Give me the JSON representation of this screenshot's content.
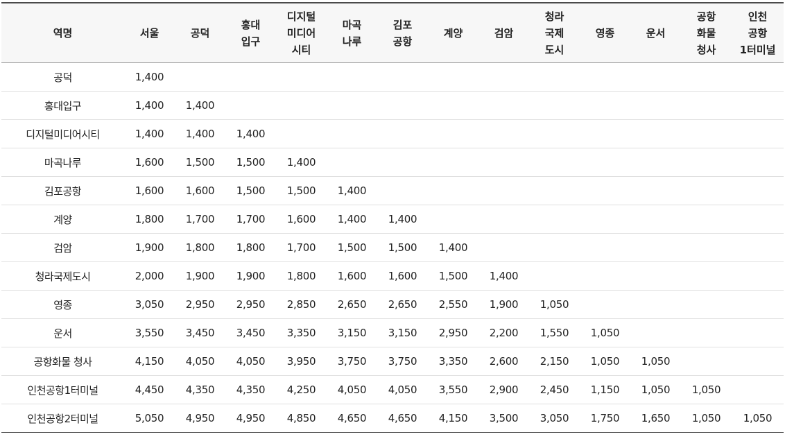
{
  "header": {
    "corner": "역명",
    "columns": [
      [
        "서울"
      ],
      [
        "공덕"
      ],
      [
        "홍대",
        "입구"
      ],
      [
        "디지털",
        "미디어",
        "시티"
      ],
      [
        "마곡",
        "나루"
      ],
      [
        "김포",
        "공항"
      ],
      [
        "계양"
      ],
      [
        "검암"
      ],
      [
        "청라",
        "국제",
        "도시"
      ],
      [
        "영종"
      ],
      [
        "운서"
      ],
      [
        "공항",
        "화물",
        "청사"
      ],
      [
        "인천",
        "공항",
        "1터미널"
      ]
    ]
  },
  "rows": [
    {
      "station": "공덕",
      "fares": [
        "1,400"
      ]
    },
    {
      "station": "홍대입구",
      "fares": [
        "1,400",
        "1,400"
      ]
    },
    {
      "station": "디지털미디어시티",
      "fares": [
        "1,400",
        "1,400",
        "1,400"
      ]
    },
    {
      "station": "마곡나루",
      "fares": [
        "1,600",
        "1,500",
        "1,500",
        "1,400"
      ]
    },
    {
      "station": "김포공항",
      "fares": [
        "1,600",
        "1,600",
        "1,500",
        "1,500",
        "1,400"
      ]
    },
    {
      "station": "계양",
      "fares": [
        "1,800",
        "1,700",
        "1,700",
        "1,600",
        "1,400",
        "1,400"
      ]
    },
    {
      "station": "검암",
      "fares": [
        "1,900",
        "1,800",
        "1,800",
        "1,700",
        "1,500",
        "1,500",
        "1,400"
      ]
    },
    {
      "station": "청라국제도시",
      "fares": [
        "2,000",
        "1,900",
        "1,900",
        "1,800",
        "1,600",
        "1,600",
        "1,500",
        "1,400"
      ]
    },
    {
      "station": "영종",
      "fares": [
        "3,050",
        "2,950",
        "2,950",
        "2,850",
        "2,650",
        "2,650",
        "2,550",
        "1,900",
        "1,050"
      ]
    },
    {
      "station": "운서",
      "fares": [
        "3,550",
        "3,450",
        "3,450",
        "3,350",
        "3,150",
        "3,150",
        "2,950",
        "2,200",
        "1,550",
        "1,050"
      ]
    },
    {
      "station": "공항화물 청사",
      "fares": [
        "4,150",
        "4,050",
        "4,050",
        "3,950",
        "3,750",
        "3,750",
        "3,350",
        "2,600",
        "2,150",
        "1,050",
        "1,050"
      ]
    },
    {
      "station": "인천공항1터미널",
      "fares": [
        "4,450",
        "4,350",
        "4,350",
        "4,250",
        "4,050",
        "4,050",
        "3,550",
        "2,900",
        "2,450",
        "1,150",
        "1,050",
        "1,050"
      ]
    },
    {
      "station": "인천공항2터미널",
      "fares": [
        "5,050",
        "4,950",
        "4,950",
        "4,850",
        "4,650",
        "4,650",
        "4,150",
        "3,500",
        "3,050",
        "1,750",
        "1,650",
        "1,050",
        "1,050"
      ]
    }
  ]
}
